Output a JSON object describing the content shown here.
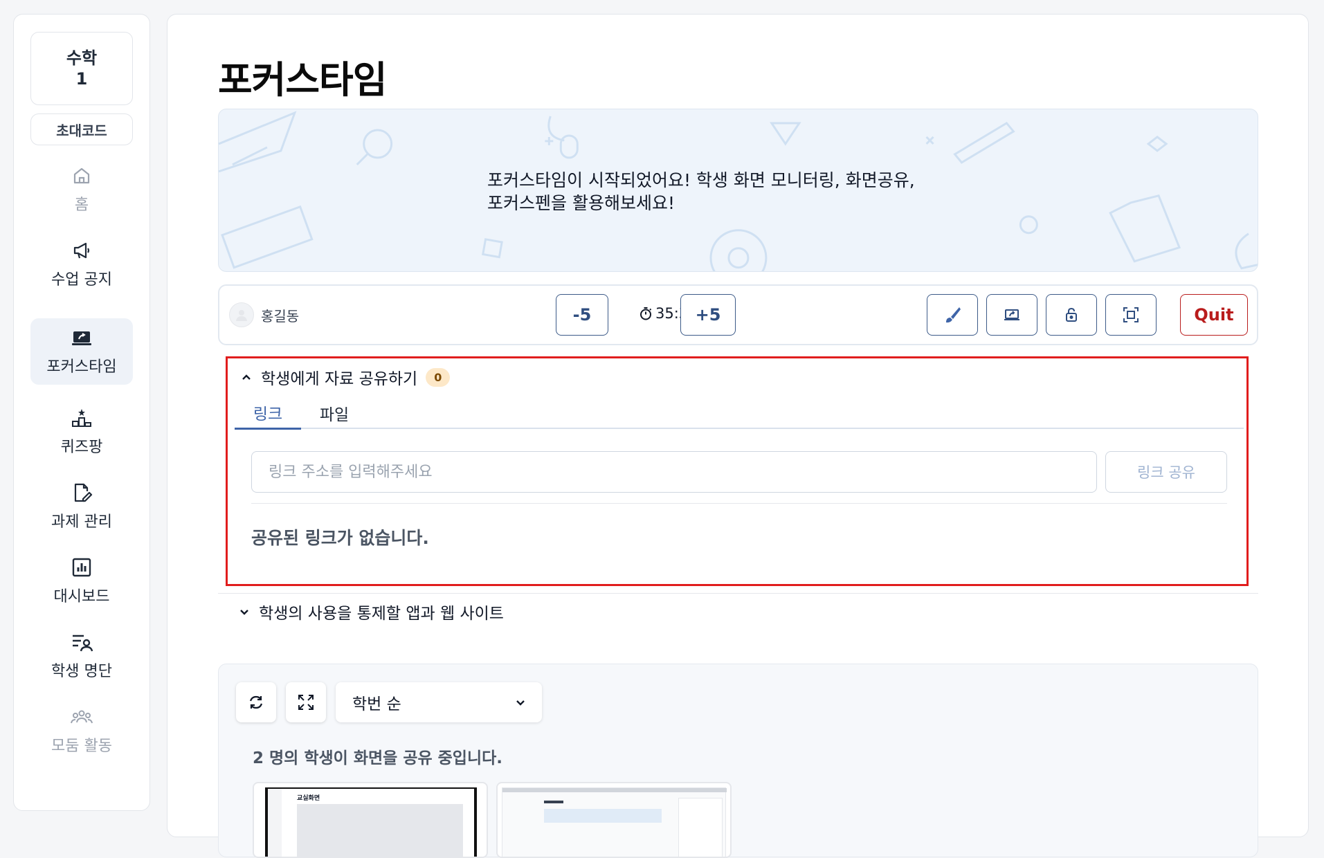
{
  "sidebar": {
    "class_name": "수학",
    "class_number": "1",
    "invite_label": "초대코드",
    "items": [
      {
        "label": "홈",
        "icon": "home-icon",
        "state": "disabled"
      },
      {
        "label": "수업 공지",
        "icon": "megaphone-icon",
        "state": "normal"
      },
      {
        "label": "포커스타임",
        "icon": "focus-screen-icon",
        "state": "active"
      },
      {
        "label": "퀴즈팡",
        "icon": "podium-icon",
        "state": "normal"
      },
      {
        "label": "과제 관리",
        "icon": "document-edit-icon",
        "state": "normal"
      },
      {
        "label": "대시보드",
        "icon": "chart-icon",
        "state": "normal"
      },
      {
        "label": "학생 명단",
        "icon": "student-list-icon",
        "state": "normal"
      },
      {
        "label": "모둠 활동",
        "icon": "group-icon",
        "state": "disabled"
      }
    ]
  },
  "page": {
    "title": "포커스타임"
  },
  "banner": {
    "line1": "포커스타임이 시작되었어요! 학생 화면 모니터링, 화면공유,",
    "line2": "포커스펜을 활용해보세요!"
  },
  "control_bar": {
    "student_name": "홍길동",
    "minus_label": "-5",
    "timer": "35:37",
    "plus_label": "+5",
    "tool_icons": [
      "brush-icon",
      "screen-share-icon",
      "lock-icon",
      "fullscreen-frame-icon"
    ],
    "quit_label": "Quit"
  },
  "share_section": {
    "title": "학생에게 자료 공유하기",
    "count": "0",
    "tabs": [
      {
        "label": "링크",
        "active": true
      },
      {
        "label": "파일",
        "active": false
      }
    ],
    "input_placeholder": "링크 주소를 입력해주세요",
    "share_button": "링크 공유",
    "empty_message": "공유된 링크가 없습니다."
  },
  "apps_section": {
    "title": "학생의 사용을 통제할 앱과 웹 사이트"
  },
  "screens": {
    "sort_selected": "학번 순",
    "share_count_text": "2 명의 학생이 화면을 공유 중입니다.",
    "thumb1_title": "교실화면"
  },
  "colors": {
    "accent": "#3e64a8",
    "danger": "#b91c1c",
    "highlight_border": "#e11d1d"
  }
}
